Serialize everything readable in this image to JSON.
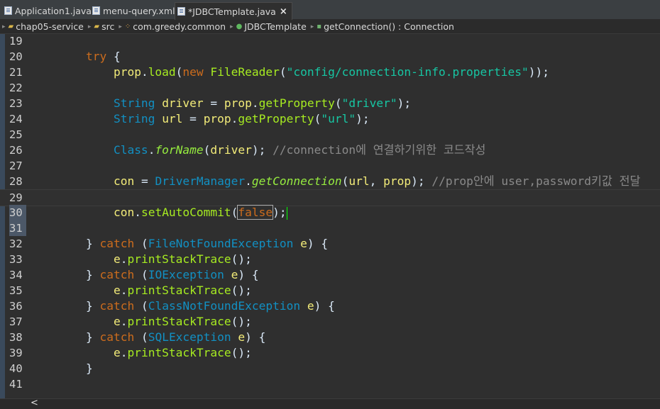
{
  "tabs": [
    {
      "label": "Application1.java",
      "active": false
    },
    {
      "label": "menu-query.xml",
      "active": false
    },
    {
      "label": "*JDBCTemplate.java",
      "active": true,
      "close": "×"
    }
  ],
  "breadcrumb": [
    "chap05-service",
    "src",
    "com.greedy.common",
    "JDBCTemplate",
    "getConnection() : Connection"
  ],
  "lines": [
    {
      "n": "19",
      "tokens": []
    },
    {
      "n": "20",
      "tokens": [
        [
          "        ",
          ""
        ],
        [
          "try",
          "kw"
        ],
        [
          " {",
          ""
        ]
      ]
    },
    {
      "n": "21",
      "tokens": [
        [
          "            ",
          ""
        ],
        [
          "prop",
          "var"
        ],
        [
          ".",
          ""
        ],
        [
          "load",
          "fn"
        ],
        [
          "(",
          ""
        ],
        [
          "new",
          "kw"
        ],
        [
          " ",
          ""
        ],
        [
          "FileReader",
          "fn"
        ],
        [
          "(",
          ""
        ],
        [
          "\"config/connection-info.properties\"",
          "str"
        ],
        [
          "));",
          ""
        ]
      ]
    },
    {
      "n": "22",
      "tokens": []
    },
    {
      "n": "23",
      "tokens": [
        [
          "            ",
          ""
        ],
        [
          "String",
          "ty"
        ],
        [
          " ",
          ""
        ],
        [
          "driver",
          "var"
        ],
        [
          " = ",
          ""
        ],
        [
          "prop",
          "var"
        ],
        [
          ".",
          ""
        ],
        [
          "getProperty",
          "fn"
        ],
        [
          "(",
          ""
        ],
        [
          "\"driver\"",
          "str"
        ],
        [
          ");",
          ""
        ]
      ]
    },
    {
      "n": "24",
      "tokens": [
        [
          "            ",
          ""
        ],
        [
          "String",
          "ty"
        ],
        [
          " ",
          ""
        ],
        [
          "url",
          "var"
        ],
        [
          " = ",
          ""
        ],
        [
          "prop",
          "var"
        ],
        [
          ".",
          ""
        ],
        [
          "getProperty",
          "fn"
        ],
        [
          "(",
          ""
        ],
        [
          "\"url\"",
          "str"
        ],
        [
          ");",
          ""
        ]
      ]
    },
    {
      "n": "25",
      "tokens": []
    },
    {
      "n": "26",
      "tokens": [
        [
          "            ",
          ""
        ],
        [
          "Class",
          "ty"
        ],
        [
          ".",
          ""
        ],
        [
          "forName",
          "it"
        ],
        [
          "(",
          ""
        ],
        [
          "driver",
          "var"
        ],
        [
          "); ",
          ""
        ],
        [
          "//connection에 연결하기위한 코드작성",
          "cm"
        ]
      ]
    },
    {
      "n": "27",
      "tokens": []
    },
    {
      "n": "28",
      "tokens": [
        [
          "            ",
          ""
        ],
        [
          "con",
          "var"
        ],
        [
          " = ",
          ""
        ],
        [
          "DriverManager",
          "ty"
        ],
        [
          ".",
          ""
        ],
        [
          "getConnection",
          "it"
        ],
        [
          "(",
          ""
        ],
        [
          "url",
          "var"
        ],
        [
          ", ",
          ""
        ],
        [
          "prop",
          "var"
        ],
        [
          "); ",
          ""
        ],
        [
          "//prop안에 user,password키값 전달",
          "cm"
        ]
      ]
    },
    {
      "n": "29",
      "tokens": []
    },
    {
      "n": "30",
      "tokens": [
        [
          "            ",
          ""
        ],
        [
          "con",
          "var"
        ],
        [
          ".",
          ""
        ],
        [
          "setAutoCommit",
          "fn"
        ],
        [
          "(",
          ""
        ],
        [
          "false",
          "kwbox"
        ],
        [
          ");",
          ""
        ]
      ]
    },
    {
      "n": "31",
      "tokens": []
    },
    {
      "n": "32",
      "tokens": [
        [
          "        ",
          ""
        ],
        [
          "} ",
          ""
        ],
        [
          "catch",
          "kw"
        ],
        [
          " (",
          ""
        ],
        [
          "FileNotFoundException",
          "ty"
        ],
        [
          " ",
          ""
        ],
        [
          "e",
          "var"
        ],
        [
          ") {",
          ""
        ]
      ]
    },
    {
      "n": "33",
      "tokens": [
        [
          "            ",
          ""
        ],
        [
          "e",
          "var"
        ],
        [
          ".",
          ""
        ],
        [
          "printStackTrace",
          "fn"
        ],
        [
          "();",
          ""
        ]
      ]
    },
    {
      "n": "34",
      "tokens": [
        [
          "        ",
          ""
        ],
        [
          "} ",
          ""
        ],
        [
          "catch",
          "kw"
        ],
        [
          " (",
          ""
        ],
        [
          "IOException",
          "ty"
        ],
        [
          " ",
          ""
        ],
        [
          "e",
          "var"
        ],
        [
          ") {",
          ""
        ]
      ]
    },
    {
      "n": "35",
      "tokens": [
        [
          "            ",
          ""
        ],
        [
          "e",
          "var"
        ],
        [
          ".",
          ""
        ],
        [
          "printStackTrace",
          "fn"
        ],
        [
          "();",
          ""
        ]
      ]
    },
    {
      "n": "36",
      "tokens": [
        [
          "        ",
          ""
        ],
        [
          "} ",
          ""
        ],
        [
          "catch",
          "kw"
        ],
        [
          " (",
          ""
        ],
        [
          "ClassNotFoundException",
          "ty"
        ],
        [
          " ",
          ""
        ],
        [
          "e",
          "var"
        ],
        [
          ") {",
          ""
        ]
      ]
    },
    {
      "n": "37",
      "tokens": [
        [
          "            ",
          ""
        ],
        [
          "e",
          "var"
        ],
        [
          ".",
          ""
        ],
        [
          "printStackTrace",
          "fn"
        ],
        [
          "();",
          ""
        ]
      ]
    },
    {
      "n": "38",
      "tokens": [
        [
          "        ",
          ""
        ],
        [
          "} ",
          ""
        ],
        [
          "catch",
          "kw"
        ],
        [
          " (",
          ""
        ],
        [
          "SQLException",
          "ty"
        ],
        [
          " ",
          ""
        ],
        [
          "e",
          "var"
        ],
        [
          ") {",
          ""
        ]
      ]
    },
    {
      "n": "39",
      "tokens": [
        [
          "            ",
          ""
        ],
        [
          "e",
          "var"
        ],
        [
          ".",
          ""
        ],
        [
          "printStackTrace",
          "fn"
        ],
        [
          "();",
          ""
        ]
      ]
    },
    {
      "n": "40",
      "tokens": [
        [
          "        ",
          ""
        ],
        [
          "}",
          ""
        ]
      ]
    },
    {
      "n": "41",
      "tokens": []
    }
  ],
  "scroll_left_arrow": "<",
  "colors": {
    "keyword": "#cc6c1d",
    "string": "#17c6a3",
    "type": "#1290c3",
    "method": "#a7ec21",
    "variable": "#f3ec79",
    "comment": "#8a8a8a",
    "background": "#2f2f2f"
  }
}
